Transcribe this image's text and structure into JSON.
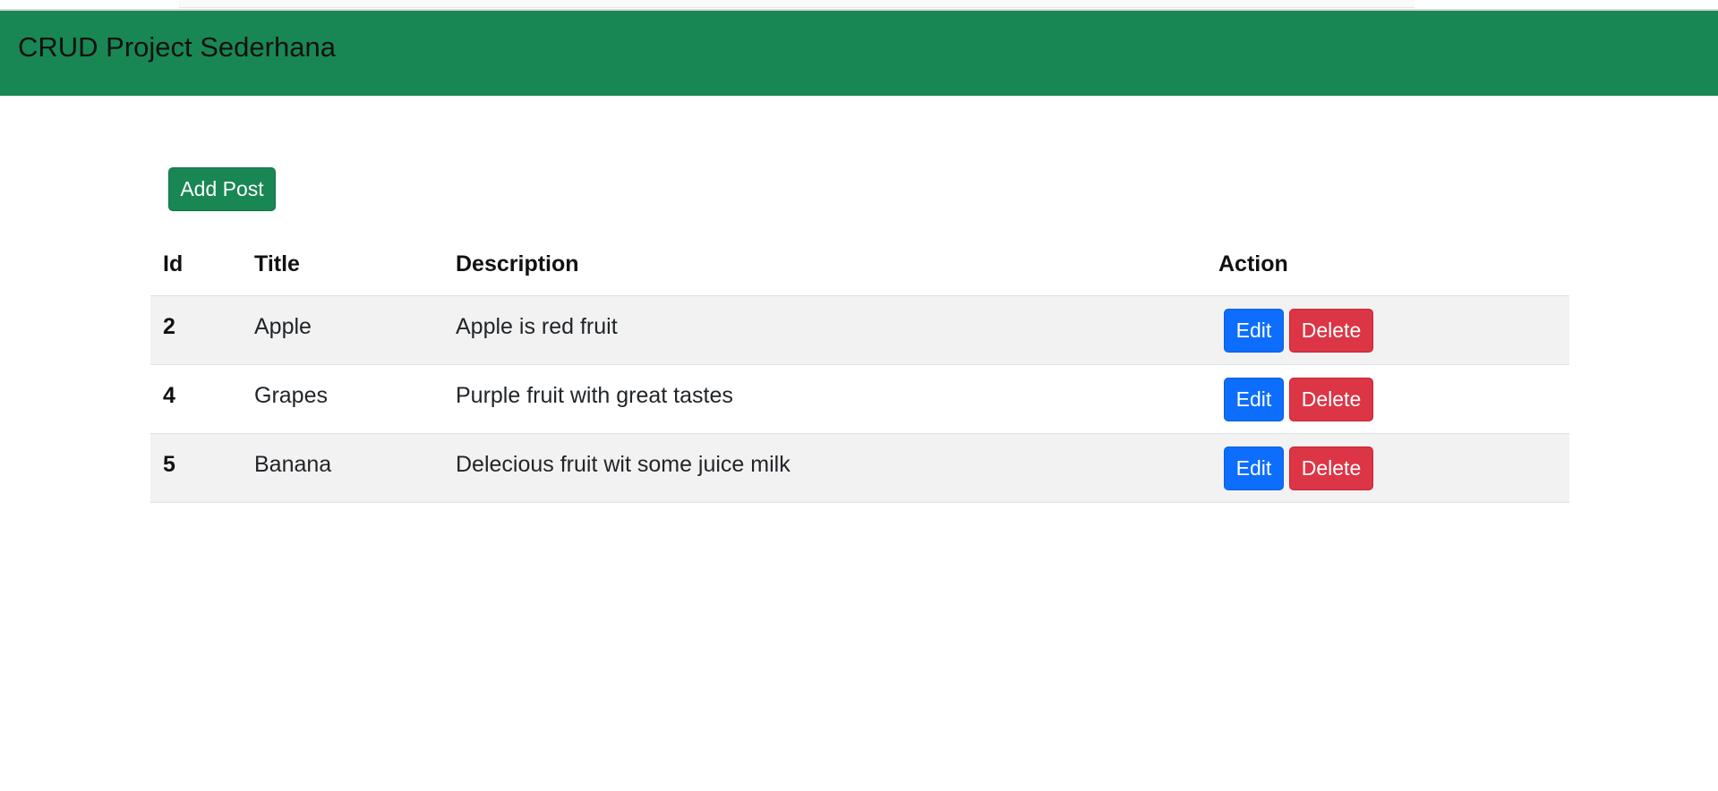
{
  "header": {
    "title": "CRUD Project Sederhana"
  },
  "actions": {
    "add_post_label": "Add Post"
  },
  "table": {
    "columns": [
      "Id",
      "Title",
      "Description",
      "Action"
    ],
    "rows": [
      {
        "id": "2",
        "title": "Apple",
        "description": "Apple is red fruit",
        "edit_label": "Edit",
        "delete_label": "Delete"
      },
      {
        "id": "4",
        "title": "Grapes",
        "description": "Purple fruit with great tastes",
        "edit_label": "Edit",
        "delete_label": "Delete"
      },
      {
        "id": "5",
        "title": "Banana",
        "description": "Delecious fruit wit some juice milk",
        "edit_label": "Edit",
        "delete_label": "Delete"
      }
    ]
  },
  "colors": {
    "navbar": "#198754",
    "add_button": "#198754",
    "edit_button": "#0d6efd",
    "delete_button": "#dc3545",
    "striped_row": "#f2f2f2"
  }
}
